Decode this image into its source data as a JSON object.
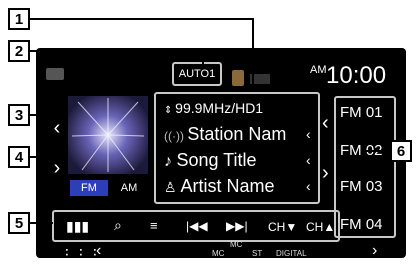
{
  "callouts": [
    "1",
    "2",
    "3",
    "4",
    "5",
    "6"
  ],
  "header": {
    "source_badge": "AUTO1",
    "am_label": "AM",
    "clock": "10:00"
  },
  "info": {
    "frequency": "99.9MHz/HD1",
    "station": "Station Nam",
    "song": "Song Title",
    "artist": "Artist Name"
  },
  "band": {
    "fm": "FM",
    "am": "AM"
  },
  "presets": [
    "FM 01",
    "FM 02",
    "FM 03",
    "FM 04"
  ],
  "controls": {
    "ch_down": "CH▼",
    "ch_up": "CH▲"
  },
  "status": {
    "mc_top": "MC",
    "mc": "MC",
    "st": "ST",
    "digital": "DIGITAL"
  }
}
